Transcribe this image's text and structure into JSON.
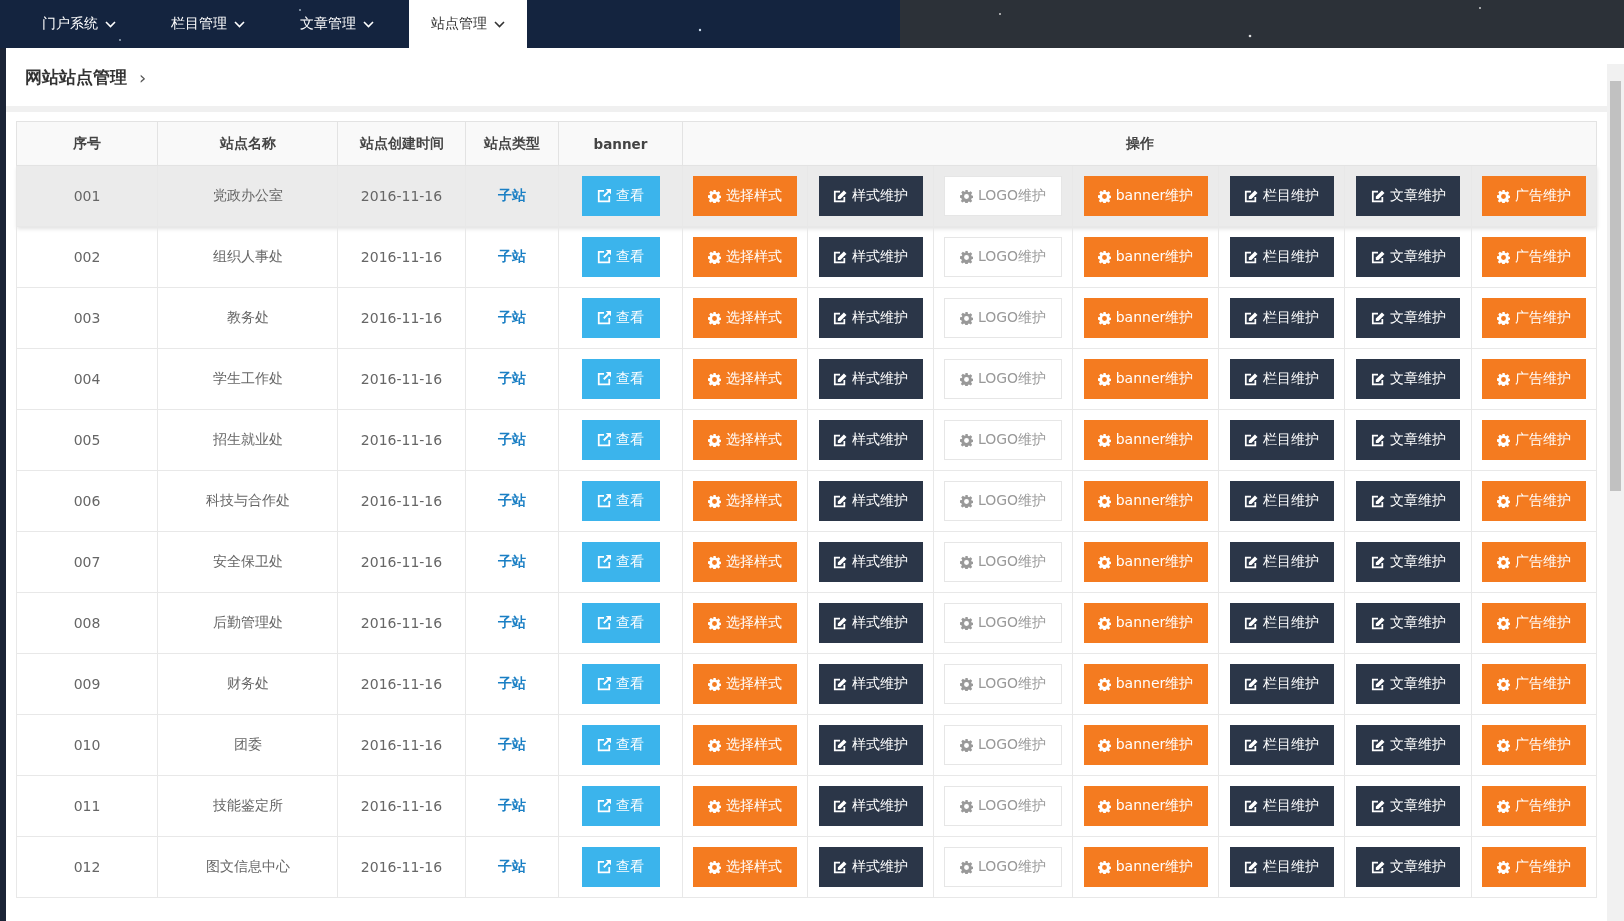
{
  "nav": {
    "tabs": [
      {
        "label": "门户系统",
        "selected": false
      },
      {
        "label": "栏目管理",
        "selected": false
      },
      {
        "label": "文章管理",
        "selected": false
      },
      {
        "label": "站点管理",
        "selected": true
      }
    ]
  },
  "breadcrumb": {
    "title": "网站站点管理",
    "separator": "›"
  },
  "table": {
    "columns": [
      "序号",
      "站点名称",
      "站点创建时间",
      "站点类型",
      "banner",
      "操作"
    ],
    "rows": [
      {
        "no": "001",
        "name": "党政办公室",
        "created": "2016-11-16",
        "type": "子站",
        "selected": true,
        "actions": [
          {
            "label": "查看",
            "kind": "info"
          },
          {
            "label": "选择样式",
            "kind": "warning"
          },
          {
            "label": "样式维护",
            "kind": "dark"
          },
          {
            "label": "LOGO维护",
            "kind": "default"
          },
          {
            "label": "banner维护",
            "kind": "warning"
          },
          {
            "label": "栏目维护",
            "kind": "dark"
          },
          {
            "label": "文章维护",
            "kind": "dark"
          },
          {
            "label": "广告维护",
            "kind": "warning"
          }
        ]
      },
      {
        "no": "002",
        "name": "组织人事处",
        "created": "2016-11-16",
        "type": "子站",
        "selected": false,
        "actions": [
          {
            "label": "查看",
            "kind": "info"
          },
          {
            "label": "选择样式",
            "kind": "warning"
          },
          {
            "label": "样式维护",
            "kind": "dark"
          },
          {
            "label": "LOGO维护",
            "kind": "default"
          },
          {
            "label": "banner维护",
            "kind": "warning"
          },
          {
            "label": "栏目维护",
            "kind": "dark"
          },
          {
            "label": "文章维护",
            "kind": "dark"
          },
          {
            "label": "广告维护",
            "kind": "warning"
          }
        ]
      },
      {
        "no": "003",
        "name": "教务处",
        "created": "2016-11-16",
        "type": "子站",
        "selected": false,
        "actions": [
          {
            "label": "查看",
            "kind": "info"
          },
          {
            "label": "选择样式",
            "kind": "warning"
          },
          {
            "label": "样式维护",
            "kind": "dark"
          },
          {
            "label": "LOGO维护",
            "kind": "default"
          },
          {
            "label": "banner维护",
            "kind": "warning"
          },
          {
            "label": "栏目维护",
            "kind": "dark"
          },
          {
            "label": "文章维护",
            "kind": "dark"
          },
          {
            "label": "广告维护",
            "kind": "warning"
          }
        ]
      },
      {
        "no": "004",
        "name": "学生工作处",
        "created": "2016-11-16",
        "type": "子站",
        "selected": false,
        "actions": [
          {
            "label": "查看",
            "kind": "info"
          },
          {
            "label": "选择样式",
            "kind": "warning"
          },
          {
            "label": "样式维护",
            "kind": "dark"
          },
          {
            "label": "LOGO维护",
            "kind": "default"
          },
          {
            "label": "banner维护",
            "kind": "warning"
          },
          {
            "label": "栏目维护",
            "kind": "dark"
          },
          {
            "label": "文章维护",
            "kind": "dark"
          },
          {
            "label": "广告维护",
            "kind": "warning"
          }
        ]
      },
      {
        "no": "005",
        "name": "招生就业处",
        "created": "2016-11-16",
        "type": "子站",
        "selected": false,
        "actions": [
          {
            "label": "查看",
            "kind": "info"
          },
          {
            "label": "选择样式",
            "kind": "warning"
          },
          {
            "label": "样式维护",
            "kind": "dark"
          },
          {
            "label": "LOGO维护",
            "kind": "default"
          },
          {
            "label": "banner维护",
            "kind": "warning"
          },
          {
            "label": "栏目维护",
            "kind": "dark"
          },
          {
            "label": "文章维护",
            "kind": "dark"
          },
          {
            "label": "广告维护",
            "kind": "warning"
          }
        ]
      },
      {
        "no": "006",
        "name": "科技与合作处",
        "created": "2016-11-16",
        "type": "子站",
        "selected": false,
        "actions": [
          {
            "label": "查看",
            "kind": "info"
          },
          {
            "label": "选择样式",
            "kind": "warning"
          },
          {
            "label": "样式维护",
            "kind": "dark"
          },
          {
            "label": "LOGO维护",
            "kind": "default"
          },
          {
            "label": "banner维护",
            "kind": "warning"
          },
          {
            "label": "栏目维护",
            "kind": "dark"
          },
          {
            "label": "文章维护",
            "kind": "dark"
          },
          {
            "label": "广告维护",
            "kind": "warning"
          }
        ]
      },
      {
        "no": "007",
        "name": "安全保卫处",
        "created": "2016-11-16",
        "type": "子站",
        "selected": false,
        "actions": [
          {
            "label": "查看",
            "kind": "info"
          },
          {
            "label": "选择样式",
            "kind": "warning"
          },
          {
            "label": "样式维护",
            "kind": "dark"
          },
          {
            "label": "LOGO维护",
            "kind": "default"
          },
          {
            "label": "banner维护",
            "kind": "warning"
          },
          {
            "label": "栏目维护",
            "kind": "dark"
          },
          {
            "label": "文章维护",
            "kind": "dark"
          },
          {
            "label": "广告维护",
            "kind": "warning"
          }
        ]
      },
      {
        "no": "008",
        "name": "后勤管理处",
        "created": "2016-11-16",
        "type": "子站",
        "selected": false,
        "actions": [
          {
            "label": "查看",
            "kind": "info"
          },
          {
            "label": "选择样式",
            "kind": "warning"
          },
          {
            "label": "样式维护",
            "kind": "dark"
          },
          {
            "label": "LOGO维护",
            "kind": "default"
          },
          {
            "label": "banner维护",
            "kind": "warning"
          },
          {
            "label": "栏目维护",
            "kind": "dark"
          },
          {
            "label": "文章维护",
            "kind": "dark"
          },
          {
            "label": "广告维护",
            "kind": "warning"
          }
        ]
      },
      {
        "no": "009",
        "name": "财务处",
        "created": "2016-11-16",
        "type": "子站",
        "selected": false,
        "actions": [
          {
            "label": "查看",
            "kind": "info"
          },
          {
            "label": "选择样式",
            "kind": "warning"
          },
          {
            "label": "样式维护",
            "kind": "dark"
          },
          {
            "label": "LOGO维护",
            "kind": "default"
          },
          {
            "label": "banner维护",
            "kind": "warning"
          },
          {
            "label": "栏目维护",
            "kind": "dark"
          },
          {
            "label": "文章维护",
            "kind": "dark"
          },
          {
            "label": "广告维护",
            "kind": "warning"
          }
        ]
      },
      {
        "no": "010",
        "name": "团委",
        "created": "2016-11-16",
        "type": "子站",
        "selected": false,
        "actions": [
          {
            "label": "查看",
            "kind": "info"
          },
          {
            "label": "选择样式",
            "kind": "warning"
          },
          {
            "label": "样式维护",
            "kind": "dark"
          },
          {
            "label": "LOGO维护",
            "kind": "default"
          },
          {
            "label": "banner维护",
            "kind": "warning"
          },
          {
            "label": "栏目维护",
            "kind": "dark"
          },
          {
            "label": "文章维护",
            "kind": "dark"
          },
          {
            "label": "广告维护",
            "kind": "warning"
          }
        ]
      },
      {
        "no": "011",
        "name": "技能鉴定所",
        "created": "2016-11-16",
        "type": "子站",
        "selected": false,
        "actions": [
          {
            "label": "查看",
            "kind": "info"
          },
          {
            "label": "选择样式",
            "kind": "warning"
          },
          {
            "label": "样式维护",
            "kind": "dark"
          },
          {
            "label": "LOGO维护",
            "kind": "default"
          },
          {
            "label": "banner维护",
            "kind": "warning"
          },
          {
            "label": "栏目维护",
            "kind": "dark"
          },
          {
            "label": "文章维护",
            "kind": "dark"
          },
          {
            "label": "广告维护",
            "kind": "warning"
          }
        ]
      },
      {
        "no": "012",
        "name": "图文信息中心",
        "created": "2016-11-16",
        "type": "子站",
        "selected": false,
        "actions": [
          {
            "label": "查看",
            "kind": "info"
          },
          {
            "label": "选择样式",
            "kind": "warning"
          },
          {
            "label": "样式维护",
            "kind": "dark"
          },
          {
            "label": "LOGO维护",
            "kind": "default"
          },
          {
            "label": "banner维护",
            "kind": "warning"
          },
          {
            "label": "栏目维护",
            "kind": "dark"
          },
          {
            "label": "文章维护",
            "kind": "dark"
          },
          {
            "label": "广告维护",
            "kind": "warning"
          }
        ]
      }
    ]
  }
}
